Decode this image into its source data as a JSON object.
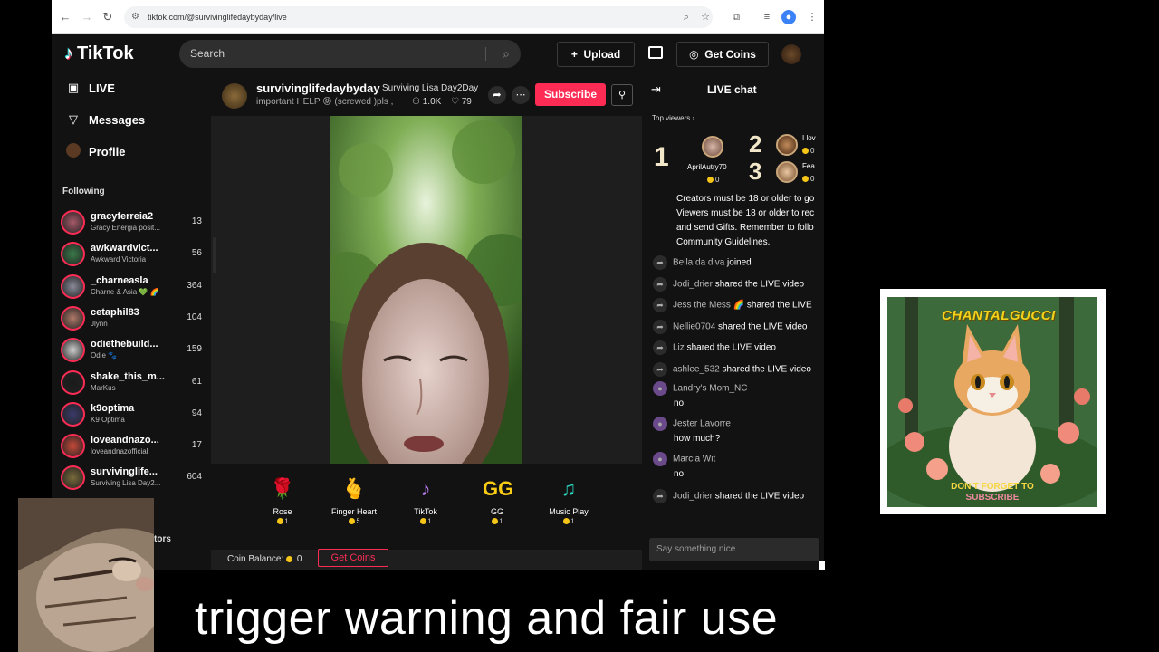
{
  "browser": {
    "url": "tiktok.com/@survivinglifedaybyday/live"
  },
  "header": {
    "logo": "TikTok",
    "search_placeholder": "Search",
    "upload_label": "Upload",
    "get_coins_label": "Get Coins"
  },
  "sidebar": {
    "nav": [
      {
        "label": "LIVE",
        "icon": "live-camera-icon"
      },
      {
        "label": "Messages",
        "icon": "paper-plane-icon"
      },
      {
        "label": "Profile",
        "icon": "avatar"
      }
    ],
    "following_title": "Following",
    "following": [
      {
        "name": "gracyferreia2",
        "sub": "Gracy Energia posit...",
        "count": "13"
      },
      {
        "name": "awkwardvict...",
        "sub": "Awkward Victoria",
        "count": "56"
      },
      {
        "name": "_charneasla",
        "sub": "Charne & Asia 💚 🌈",
        "count": "364"
      },
      {
        "name": "cetaphil83",
        "sub": "Jlynn",
        "count": "104"
      },
      {
        "name": "odiethebuild...",
        "sub": "Odie 🐾",
        "count": "159"
      },
      {
        "name": "shake_this_m...",
        "sub": "MarKus",
        "count": "61"
      },
      {
        "name": "k9optima",
        "sub": "K9 Optima",
        "count": "94"
      },
      {
        "name": "loveandnazo...",
        "sub": "loveandnazofficial",
        "count": "17"
      },
      {
        "name": "survivinglife...",
        "sub": "Surviving Lisa Day2...",
        "count": "604"
      }
    ],
    "partial_label": "tors"
  },
  "stream": {
    "host": "survivinglifedaybyday",
    "host_sub": "Surviving Lisa Day2Day",
    "title": "important HELP 😡 (screwed )pls ,",
    "viewers": "1.0K",
    "likes": "79",
    "subscribe_label": "Subscribe"
  },
  "gifts": [
    {
      "name": "Rose",
      "cost": "1",
      "glyph": "🌹",
      "color": "#e11d48"
    },
    {
      "name": "Finger Heart",
      "cost": "5",
      "glyph": "🫰",
      "color": "#f59e0b"
    },
    {
      "name": "TikTok",
      "cost": "1",
      "glyph": "♪",
      "color": "#c084fc"
    },
    {
      "name": "GG",
      "cost": "1",
      "glyph": "GG",
      "color": "#facc15"
    },
    {
      "name": "Music Play",
      "cost": "1",
      "glyph": "♫",
      "color": "#2dd4bf"
    }
  ],
  "coin_balance_label": "Coin Balance:",
  "coin_balance_value": "0",
  "get_coins_small": "Get Coins",
  "chat": {
    "title": "LIVE chat",
    "top_viewers_label": "Top viewers",
    "top_viewers": [
      {
        "rank": "1",
        "name": "AprilAutry70",
        "coins": "0"
      },
      {
        "rank": "2",
        "name": "I lov",
        "coins": "0"
      },
      {
        "rank": "3",
        "name": "Fea",
        "coins": "0"
      }
    ],
    "guidelines": [
      "Creators must be 18 or older to go",
      "Viewers must be 18 or older to rec",
      "and send Gifts. Remember to follo",
      "Community Guidelines."
    ],
    "messages": [
      {
        "user": "Bella da diva",
        "text": "joined",
        "type": "event"
      },
      {
        "user": "Jodi_drier",
        "text": "shared the LIVE video",
        "type": "event"
      },
      {
        "user": "Jess the Mess 🌈",
        "text": "shared the LIVE",
        "type": "event"
      },
      {
        "user": "Nellie0704",
        "text": "shared the LIVE video",
        "type": "event"
      },
      {
        "user": "Liz",
        "text": "shared the LIVE video",
        "type": "event"
      },
      {
        "user": "ashlee_532",
        "text": "shared the LIVE video",
        "type": "event"
      },
      {
        "user": "Landry's Mom_NC",
        "text": "no",
        "type": "msg"
      },
      {
        "user": "Jester Lavorre",
        "text": "how much?",
        "type": "msg"
      },
      {
        "user": "Marcia Wit",
        "text": "no",
        "type": "msg"
      },
      {
        "user": "Jodi_drier",
        "text": "shared the LIVE video",
        "type": "event"
      }
    ],
    "input_placeholder": "Say something nice"
  },
  "overlay": {
    "channel_logo_text": "CHANTALGUCCI",
    "cat_text_1": "DON'T FORGET TO",
    "cat_text_2": "SUBSCRIBE",
    "caption": "trigger warning and fair use"
  }
}
